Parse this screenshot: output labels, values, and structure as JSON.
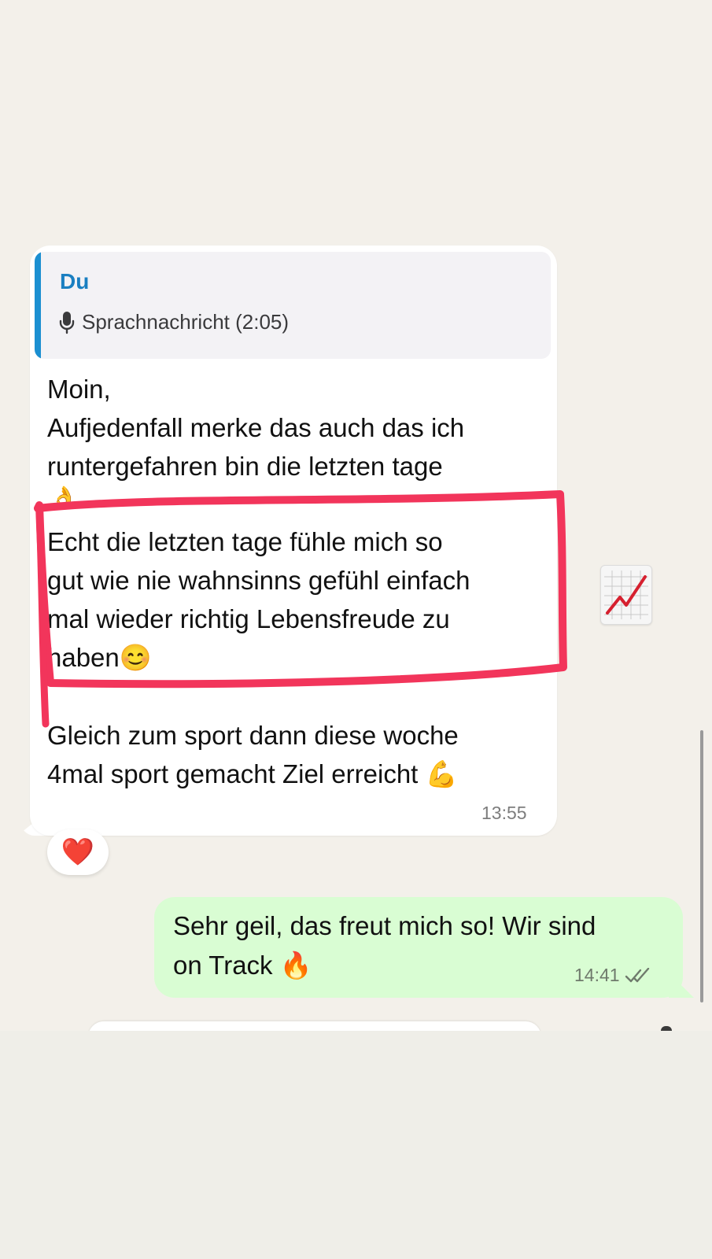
{
  "incoming_message": {
    "quote": {
      "author": "Du",
      "type_label": "Sprachnachricht (2:05)"
    },
    "lines": [
      "Moin,",
      "Aufjedenfall merke das  auch das ich",
      "runtergefahren bin die letzten tage",
      "👌",
      "Echt die letzten tage fühle mich so",
      "gut wie nie wahnsinns gefühl einfach",
      "mal wieder richtig Lebensfreude zu",
      "haben😊",
      "Gleich zum sport dann diese woche",
      "4mal sport gemacht Ziel erreicht 💪"
    ],
    "time": "13:55",
    "reaction": "❤️"
  },
  "reaction_sticker": "chart-increasing-emoji",
  "outgoing_message": {
    "lines": [
      "Sehr geil, das freut mich so! Wir sind",
      "on Track 🔥"
    ],
    "time": "14:41",
    "status_icon": "double-check-icon"
  },
  "colors": {
    "chat_background": "#f3f0ea",
    "incoming_bubble": "#ffffff",
    "outgoing_bubble": "#d9fdd3",
    "quote_accent": "#1b8fd1",
    "annotation_stroke": "#f2355b"
  }
}
